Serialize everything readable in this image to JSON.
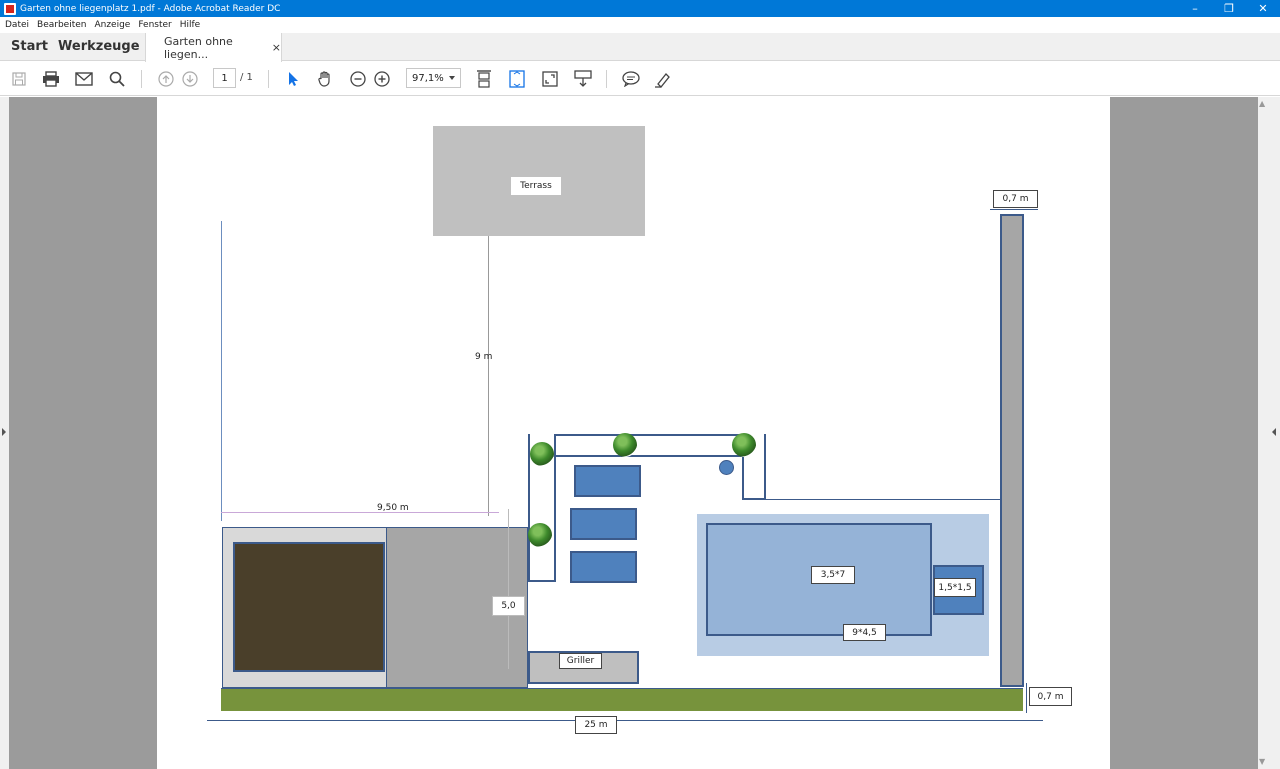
{
  "window": {
    "title": "Garten ohne liegenplatz 1.pdf - Adobe Acrobat Reader DC",
    "minimize": "–",
    "restore": "❐",
    "close": "✕"
  },
  "menu": {
    "items": [
      {
        "label": "Datei"
      },
      {
        "label": "Bearbeiten"
      },
      {
        "label": "Anzeige"
      },
      {
        "label": "Fenster"
      },
      {
        "label": "Hilfe"
      }
    ]
  },
  "tabs": {
    "start": "Start",
    "tools": "Werkzeuge",
    "document": "Garten ohne liegen...",
    "document_close": "×"
  },
  "toolbar": {
    "page_current": "1",
    "page_total": "/ 1",
    "zoom": "97,1%"
  },
  "plan": {
    "terrace": "Terrass",
    "dim_depth": "9 m",
    "dim_width_left": "9,50 m",
    "dim_inner": "5,0",
    "dim_pool_inner": "3,5*7",
    "dim_pool_outer": "9*4,5",
    "dim_jacuzzi": "1,5*1,5",
    "grill": "Griller",
    "dim_wall_top": "0,7 m",
    "dim_wall_bottom": "0,7 m",
    "dim_total": "25 m"
  },
  "colors": {
    "titlebar": "#0078d7",
    "gutter": "#9b9b9b",
    "pool_outer": "#b8cce4",
    "pool_inner": "#95b3d7",
    "border_blue": "#3c5a8a",
    "lounger": "#4f81bd",
    "grass": "#77933c",
    "soil": "#4a3f2a",
    "wall": "#a6a6a6"
  }
}
